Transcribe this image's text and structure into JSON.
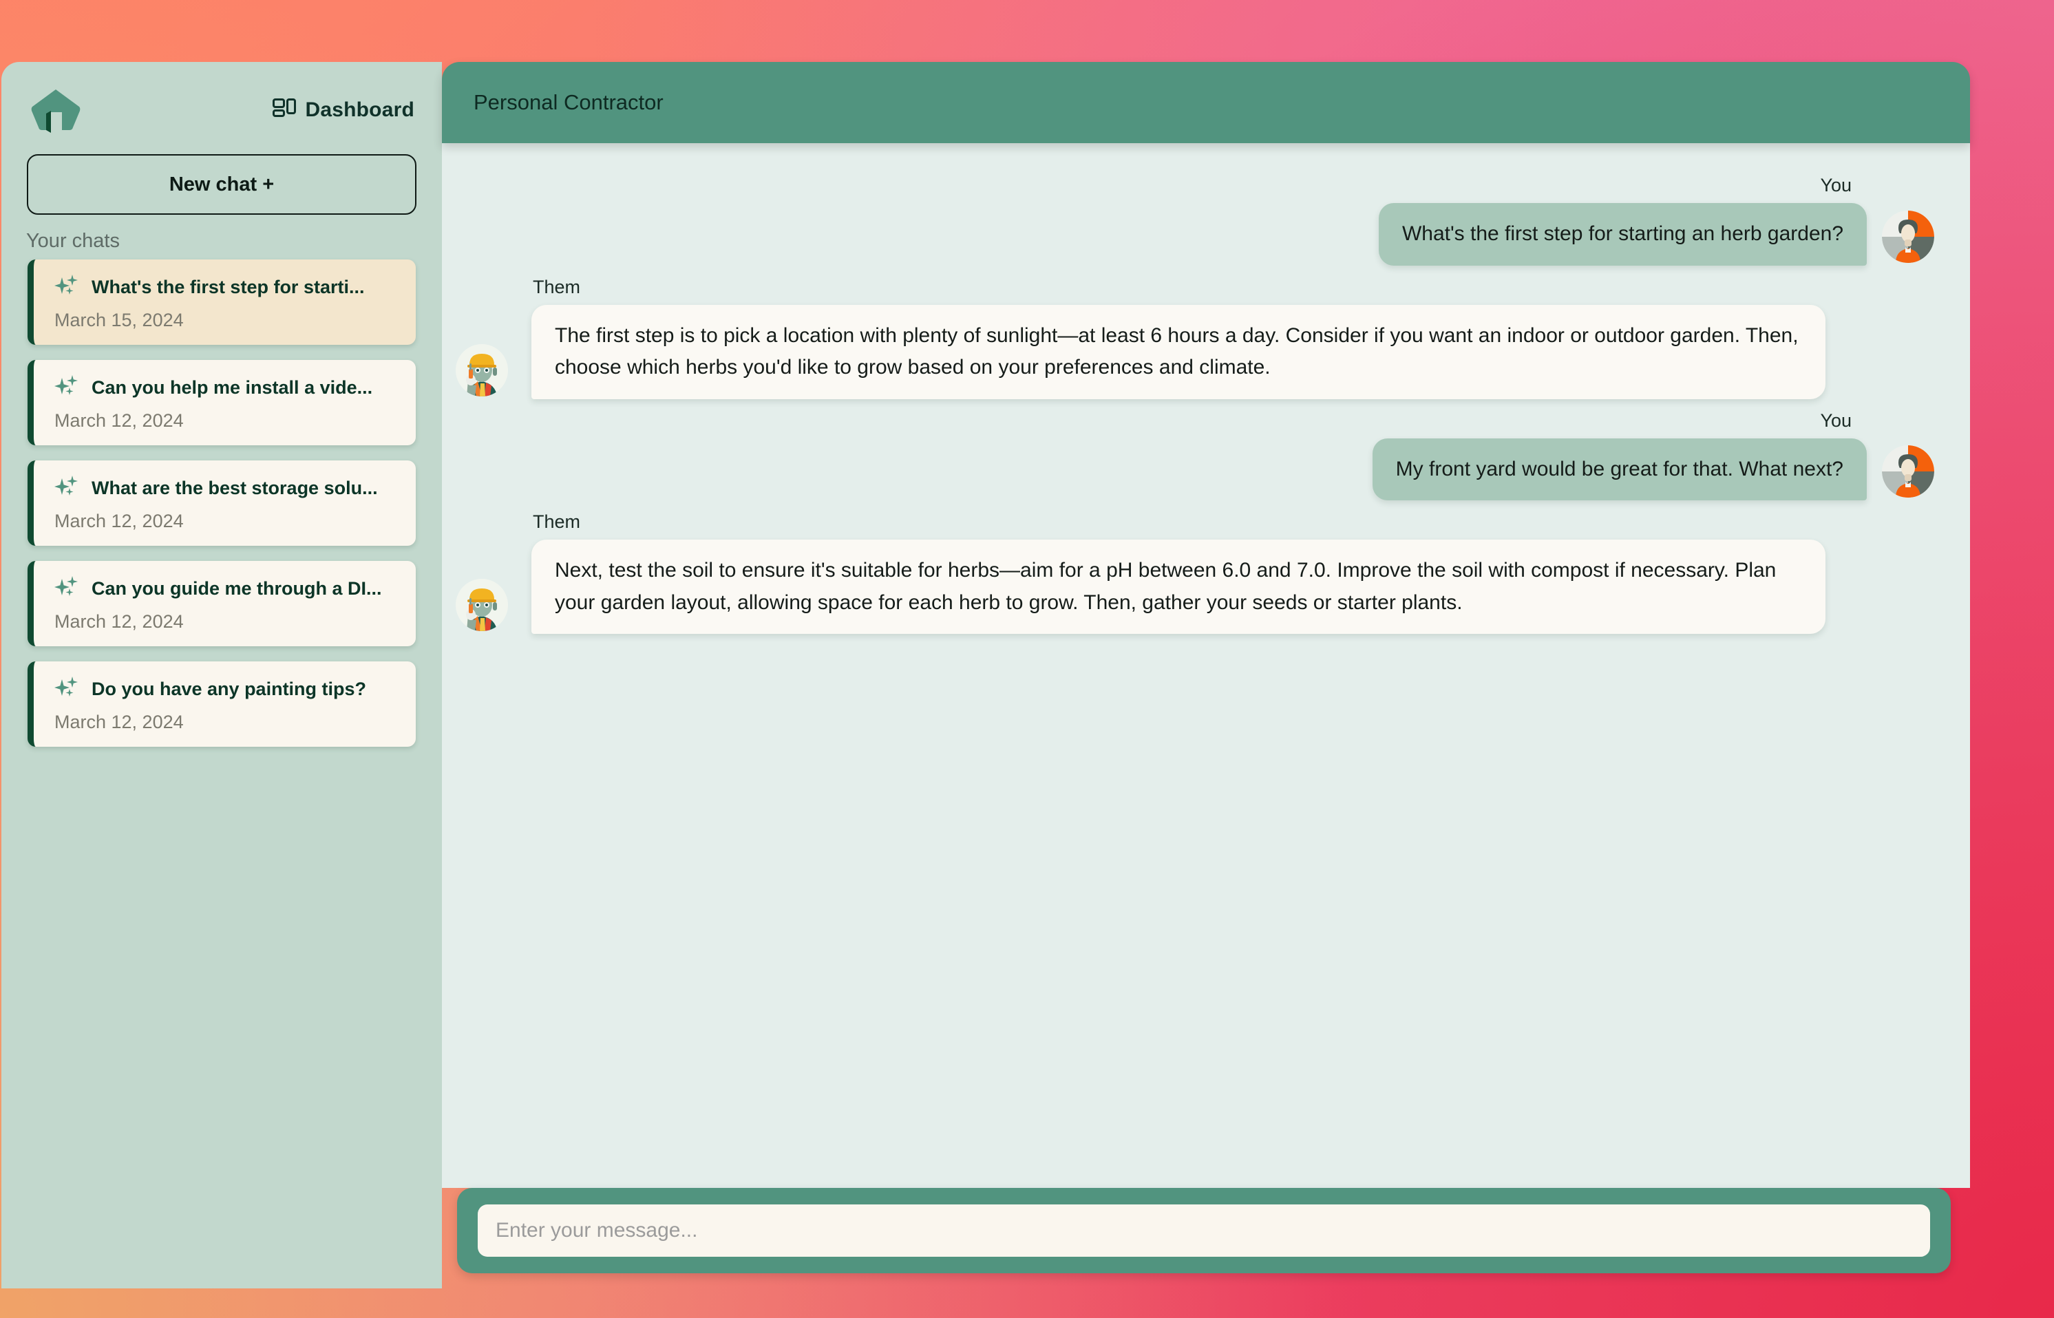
{
  "sidebar": {
    "logo_icon": "home-icon",
    "dashboard": {
      "label": "Dashboard",
      "icon": "dashboard-layout-icon"
    },
    "new_chat_label": "New chat +",
    "your_chats_label": "Your chats",
    "chats": [
      {
        "icon": "sparkle-icon",
        "title": "What's the first step for starti...",
        "date": "March 15, 2024",
        "active": true
      },
      {
        "icon": "sparkle-icon",
        "title": "Can you help me install a vide...",
        "date": "March 12, 2024",
        "active": false
      },
      {
        "icon": "sparkle-icon",
        "title": "What are the best storage solu...",
        "date": "March 12, 2024",
        "active": false
      },
      {
        "icon": "sparkle-icon",
        "title": "Can you guide me through a DI...",
        "date": "March 12, 2024",
        "active": false
      },
      {
        "icon": "sparkle-icon",
        "title": "Do you have any painting tips?",
        "date": "March 12, 2024",
        "active": false
      }
    ]
  },
  "chat": {
    "title": "Personal Contractor",
    "messages": [
      {
        "sender_label": "You",
        "side": "right",
        "text": "What's the first step for starting an herb garden?",
        "avatar": "user-avatar"
      },
      {
        "sender_label": "Them",
        "side": "left",
        "text": "The first step is to pick a location with plenty of sunlight—at least 6 hours a day. Consider if you want an indoor or outdoor garden. Then, choose which herbs you'd like to grow based on your preferences and climate.",
        "avatar": "contractor-avatar"
      },
      {
        "sender_label": "You",
        "side": "right",
        "text": "My front yard would be great for that. What next?",
        "avatar": "user-avatar"
      },
      {
        "sender_label": "Them",
        "side": "left",
        "text": "Next, test the soil to ensure it's suitable for herbs—aim for a pH between 6.0 and 7.0. Improve the soil with compost if necessary. Plan your garden layout, allowing space for each herb to grow. Then, gather your seeds or starter plants.",
        "avatar": "contractor-avatar"
      }
    ]
  },
  "composer": {
    "placeholder": "Enter your message...",
    "value": ""
  },
  "colors": {
    "sidebar_bg": "#c2d8cd",
    "header_green": "#51947f",
    "accent_dark_green": "#0f4a31",
    "chat_bg": "#e4eeeb",
    "card_cream": "#faf6ee",
    "card_active": "#f3e6cd",
    "you_bubble": "#a8c8b9",
    "them_bubble": "#fbf9f4"
  }
}
